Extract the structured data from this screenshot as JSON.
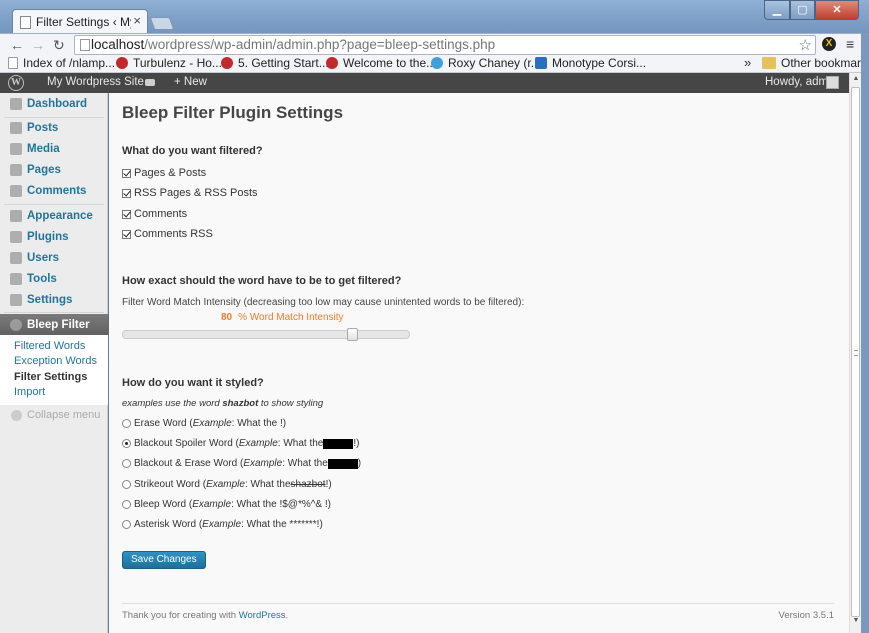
{
  "browser": {
    "tab_title": "Filter Settings ‹ My W",
    "tab_close": "×",
    "url_host": "localhost",
    "url_path": "/wordpress/wp-admin/admin.php?page=bleep-settings.php",
    "bookmarks": [
      {
        "label": "Index of /nlamp...",
        "icon": "doc"
      },
      {
        "label": "Turbulenz - Ho...",
        "icon": "red"
      },
      {
        "label": "5. Getting Start...",
        "icon": "red"
      },
      {
        "label": "Welcome to the...",
        "icon": "red"
      },
      {
        "label": "Roxy Chaney (r...",
        "icon": "bird"
      },
      {
        "label": "Monotype Corsi...",
        "icon": "blue"
      }
    ],
    "bookmarks_more": "»",
    "other_bookmarks": "Other bookmarks"
  },
  "adminbar": {
    "site_name": "My Wordpress Site",
    "new_label": "+ New",
    "howdy": "Howdy, admin"
  },
  "sidebar": {
    "items": [
      {
        "label": "Dashboard",
        "icon": "dashboard-icon"
      },
      {
        "label": "Posts",
        "icon": "posts-icon"
      },
      {
        "label": "Media",
        "icon": "media-icon"
      },
      {
        "label": "Pages",
        "icon": "pages-icon"
      },
      {
        "label": "Comments",
        "icon": "comments-icon"
      },
      {
        "label": "Appearance",
        "icon": "appearance-icon"
      },
      {
        "label": "Plugins",
        "icon": "plugins-icon"
      },
      {
        "label": "Users",
        "icon": "users-icon"
      },
      {
        "label": "Tools",
        "icon": "tools-icon"
      },
      {
        "label": "Settings",
        "icon": "settings-icon"
      },
      {
        "label": "Bleep Filter",
        "icon": "bleep-filter-icon"
      }
    ],
    "submenu": [
      "Filtered Words",
      "Exception Words",
      "Filter Settings",
      "Import"
    ],
    "collapse": "Collapse menu"
  },
  "main": {
    "title": "Bleep Filter Plugin Settings",
    "section1": {
      "heading": "What do you want filtered?",
      "options": [
        "Pages & Posts",
        "RSS Pages & RSS Posts",
        "Comments",
        "Comments RSS"
      ]
    },
    "section2": {
      "heading": "How exact should the word have to be to get filtered?",
      "description": "Filter Word Match Intensity (decreasing too low may cause unintented words to be filtered):",
      "value": "80",
      "value_suffix": "% Word Match Intensity",
      "slider_fraction": 0.8
    },
    "section3": {
      "heading": "How do you want it styled?",
      "note_prefix": "examples use the word ",
      "note_word": "shazbot",
      "note_suffix": " to show styling",
      "example_label": "Example",
      "options": [
        {
          "label": "Erase Word",
          "example": ": What the !)",
          "pre": "",
          "styled": "",
          "post": ""
        },
        {
          "label": "Blackout Spoiler Word",
          "pre": ": What the ",
          "post": "!)",
          "selected": true
        },
        {
          "label": "Blackout & Erase Word",
          "pre": ": What the ",
          "post": ")"
        },
        {
          "label": "Strikeout Word",
          "pre": ": What the ",
          "styled": "shazbot",
          "post": "!)"
        },
        {
          "label": "Bleep Word",
          "example": ": What the !$@*%^& !)"
        },
        {
          "label": "Asterisk Word",
          "example": ": What the *******!)"
        }
      ]
    },
    "save_label": "Save Changes",
    "footer_prefix": "Thank you for creating with ",
    "footer_link": "WordPress",
    "footer_suffix": ".",
    "version": "Version 3.5.1"
  }
}
